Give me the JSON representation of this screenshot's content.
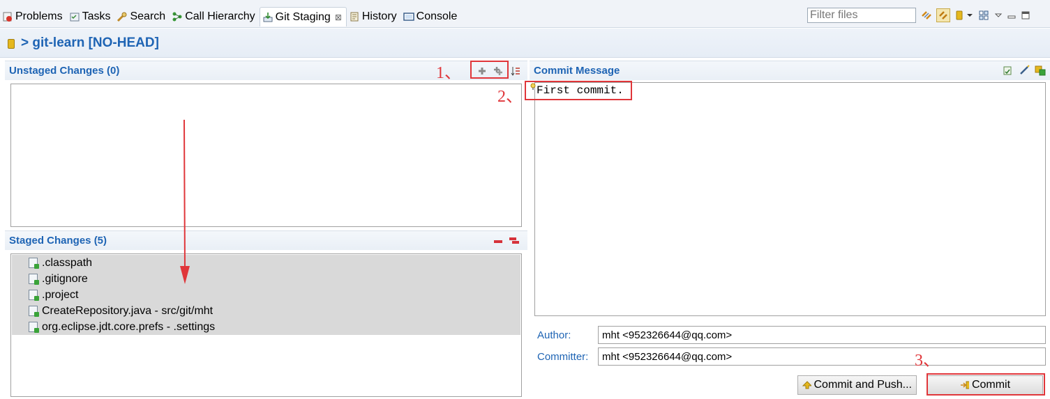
{
  "tabs": [
    {
      "label": "Problems",
      "icon": "problems-icon"
    },
    {
      "label": "Tasks",
      "icon": "tasks-icon"
    },
    {
      "label": "Search",
      "icon": "search-icon"
    },
    {
      "label": "Call Hierarchy",
      "icon": "call-hierarchy-icon"
    },
    {
      "label": "Git Staging",
      "icon": "git-staging-icon",
      "active": true,
      "close": "⊠"
    },
    {
      "label": "History",
      "icon": "history-icon"
    },
    {
      "label": "Console",
      "icon": "console-icon"
    }
  ],
  "filter": {
    "placeholder": "Filter files"
  },
  "repo": {
    "title": "> git-learn [NO-HEAD]"
  },
  "unstaged": {
    "title": "Unstaged Changes (0)"
  },
  "staged": {
    "title": "Staged Changes (5)",
    "files": [
      ".classpath",
      ".gitignore",
      ".project",
      "CreateRepository.java - src/git/mht",
      "org.eclipse.jdt.core.prefs - .settings"
    ]
  },
  "commit_message": {
    "title": "Commit Message",
    "text": "First commit."
  },
  "author": {
    "label": "Author:",
    "value": "mht <952326644@qq.com>"
  },
  "committer": {
    "label": "Committer:",
    "value": "mht <952326644@qq.com>"
  },
  "buttons": {
    "commit_and_push": "Commit and Push...",
    "commit": "Commit"
  },
  "annotations": {
    "one": "1、",
    "two": "2、",
    "three": "3、"
  },
  "colors": {
    "accent": "#1e64b4",
    "annotation_red": "#e0363a",
    "selection_gray": "#d9d9d9"
  }
}
